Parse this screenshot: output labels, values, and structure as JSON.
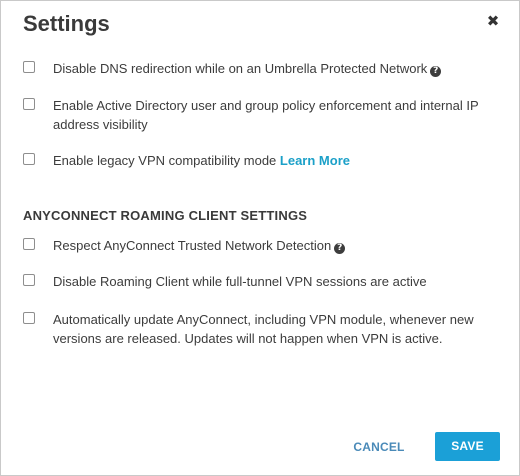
{
  "dialog": {
    "title": "Settings",
    "close_glyph": "✖"
  },
  "options": [
    {
      "text": "Disable DNS redirection while on an Umbrella Protected Network",
      "checked": false,
      "help_icon": "question-circle-icon"
    },
    {
      "text": "Enable Active Directory user and group policy enforcement and internal IP address visibility",
      "checked": false
    },
    {
      "text": "Enable legacy VPN compatibility mode",
      "link": "Learn More",
      "checked": false
    }
  ],
  "section": {
    "heading": "ANYCONNECT ROAMING CLIENT SETTINGS"
  },
  "roaming_options": [
    {
      "text": "Respect AnyConnect Trusted Network Detection",
      "checked": false,
      "help_icon": "question-circle-icon"
    },
    {
      "text": "Disable Roaming Client while full-tunnel VPN sessions are active",
      "checked": false
    },
    {
      "text": "Automatically update AnyConnect, including VPN module, whenever new versions are released. Updates will not happen when VPN is active.",
      "checked": false
    }
  ],
  "footer": {
    "cancel_label": "CANCEL",
    "save_label": "SAVE"
  },
  "colors": {
    "accent": "#1ba0d7",
    "link": "#1ba0c8",
    "cancel_text": "#4a8ab8"
  }
}
